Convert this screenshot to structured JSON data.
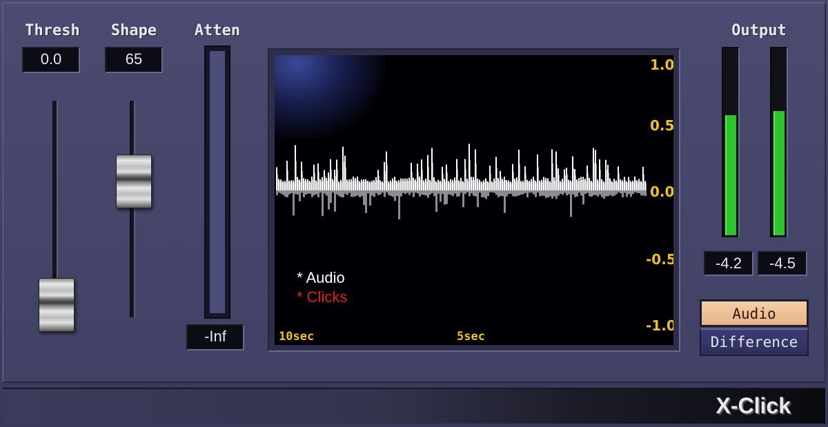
{
  "controls": {
    "thresh": {
      "label": "Thresh",
      "value": "0.0",
      "level": 0.0
    },
    "shape": {
      "label": "Shape",
      "value": "65",
      "level": 0.65
    },
    "atten": {
      "label": "Atten",
      "value": "-Inf"
    }
  },
  "display": {
    "y_ticks": [
      "1.0",
      "0.5",
      "0.0",
      "-0.5",
      "-1.0"
    ],
    "x_ticks": [
      "10sec",
      "5sec"
    ],
    "legend": [
      {
        "label": "* Audio",
        "color": "#ffffff"
      },
      {
        "label": "* Clicks",
        "color": "#e0201a"
      }
    ],
    "waveform_color": "#ffffff",
    "waveform_shadow_color": "#8c8c96"
  },
  "output": {
    "label": "Output",
    "left_value": "-4.2",
    "right_value": "-4.5",
    "left_level": 0.65,
    "right_level": 0.67,
    "meter_color": "#2ec42e"
  },
  "mode": {
    "audio_label": "Audio",
    "difference_label": "Difference",
    "selected": "Audio"
  },
  "brand": "X-Click"
}
